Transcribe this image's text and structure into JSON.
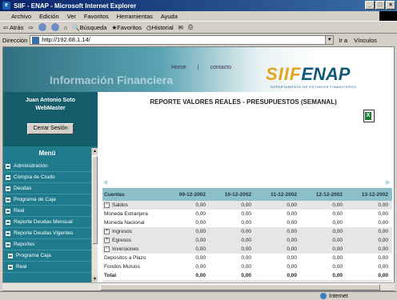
{
  "window": {
    "title": "SIIF - ENAP - Microsoft Internet Explorer",
    "controls": [
      "_",
      "□",
      "×"
    ]
  },
  "menubar": [
    "Archivo",
    "Edición",
    "Ver",
    "Favoritos",
    "Herramientas",
    "Ayuda"
  ],
  "toolbar": {
    "back": "Atrás",
    "search": "Búsqueda",
    "favorites": "Favoritos",
    "history": "Historial"
  },
  "addressbar": {
    "label": "Dirección",
    "url": "http://192.68.1.14/",
    "go": "Ir a",
    "links": "Vínculos"
  },
  "banner": {
    "nav_home": "Home",
    "nav_sep": "|",
    "nav_contact": "contacto",
    "bg_text": "Información Financiera",
    "logo_left": "SIIF",
    "logo_right": "ENAP",
    "logo_sub": "DEPARTAMENTO DE ESTUDIOS FINANCIEROS",
    "logo_sub2": "GRUPO DE EMPRESAS"
  },
  "user": {
    "name": "Juan Antonio Soto",
    "role": "WebMaster",
    "logout": "Cerrar Sesión"
  },
  "menu": {
    "title": "Menú",
    "items": [
      {
        "label": "Administración",
        "sub": false
      },
      {
        "label": "Compra de Crudo",
        "sub": false
      },
      {
        "label": "Deudas",
        "sub": false
      },
      {
        "label": "Programa de Caja",
        "sub": false
      },
      {
        "label": "Real",
        "sub": false
      },
      {
        "label": "Reporte Deudas Mensual",
        "sub": false
      },
      {
        "label": "Reporte Deudas Vigentes",
        "sub": false
      },
      {
        "label": "Reportes",
        "sub": false
      },
      {
        "label": "Programa Caja",
        "sub": true
      },
      {
        "label": "Real",
        "sub": true
      }
    ]
  },
  "report": {
    "title": "REPORTE VALORES REALES - PRESUPUESTOS (SEMANAL)",
    "columns": [
      "Cuentas",
      "09-12-2002",
      "10-12-2002",
      "11-12-2002",
      "12-12-2002",
      "13-12-2002"
    ],
    "rows": [
      {
        "label": "Saldos",
        "toggle": "−",
        "values": [
          "0,00",
          "0,00",
          "0,00",
          "0,00",
          "0,00"
        ],
        "shade": true
      },
      {
        "label": "Moneda Extranjera",
        "toggle": "",
        "values": [
          "0,00",
          "0,00",
          "0,00",
          "0,00",
          "0,00"
        ],
        "shade": false
      },
      {
        "label": "Moneda Nacional",
        "toggle": "",
        "values": [
          "0,00",
          "0,00",
          "0,00",
          "0,00",
          "0,00"
        ],
        "shade": false
      },
      {
        "label": "Ingresos",
        "toggle": "+",
        "values": [
          "0,00",
          "0,00",
          "0,00",
          "0,00",
          "0,00"
        ],
        "shade": true
      },
      {
        "label": "Egresos",
        "toggle": "+",
        "values": [
          "0,00",
          "0,00",
          "0,00",
          "0,00",
          "0,00"
        ],
        "shade": true
      },
      {
        "label": "Inversiones",
        "toggle": "−",
        "values": [
          "0,00",
          "0,00",
          "0,00",
          "0,00",
          "0,00"
        ],
        "shade": true
      },
      {
        "label": "Depositos a Plazo",
        "toggle": "",
        "values": [
          "0,00",
          "0,00",
          "0,00",
          "0,00",
          "0,00"
        ],
        "shade": false
      },
      {
        "label": "Fondos Mutuos",
        "toggle": "",
        "values": [
          "0,00",
          "0,00",
          "0,00",
          "0,00",
          "0,00"
        ],
        "shade": false
      },
      {
        "label": "Total",
        "toggle": "",
        "values": [
          "0,00",
          "0,00",
          "0,00",
          "0,00",
          "0,00"
        ],
        "shade": false,
        "total": true
      }
    ]
  },
  "status": {
    "zone": "Internet"
  },
  "colors": {
    "titlebar": "#0a246a",
    "sidebar": "#1f7a8c",
    "grid_header": "#8bc0cb",
    "logo_gold": "#e3a520",
    "logo_blue": "#0f5a7a"
  },
  "icons": [
    "ie-icon",
    "back-icon",
    "forward-icon",
    "stop-icon",
    "refresh-icon",
    "home-icon",
    "search-icon",
    "favorites-icon",
    "history-icon",
    "mail-icon",
    "print-icon",
    "excel-export-icon",
    "globe-icon"
  ]
}
